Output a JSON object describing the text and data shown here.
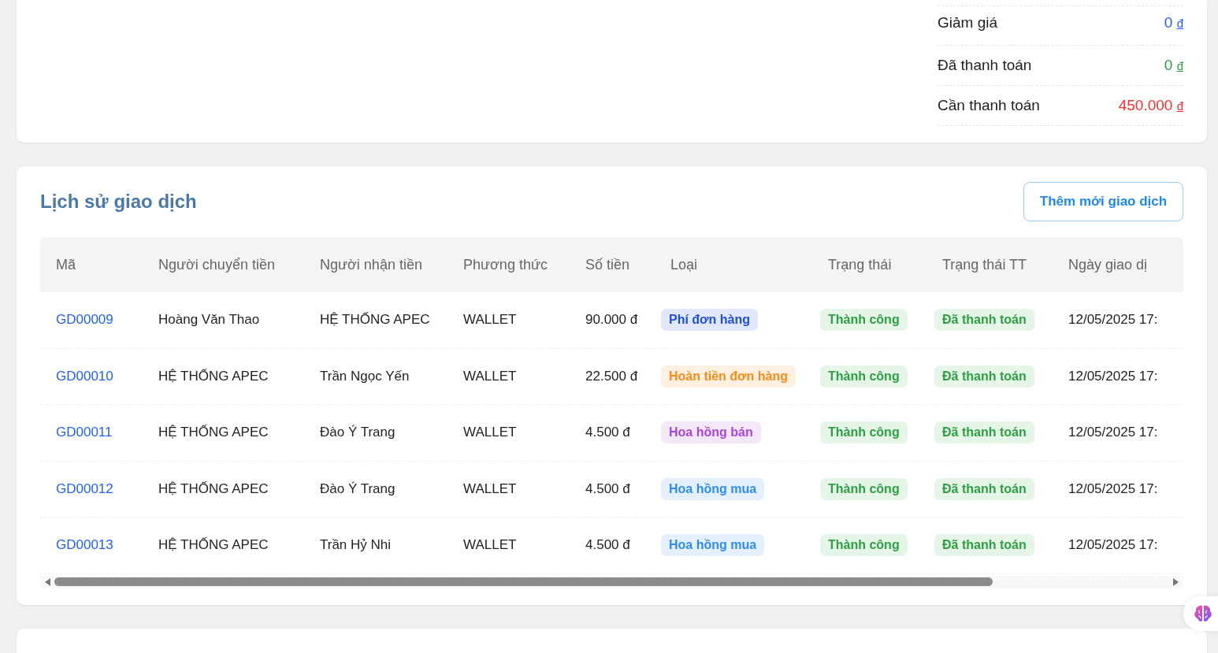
{
  "summary": [
    {
      "label": "Giảm giá",
      "value": "0",
      "currency": "đ",
      "color": "#1f5eff"
    },
    {
      "label": "Đã thanh toán",
      "value": "0",
      "currency": "đ",
      "color": "#2ea043"
    },
    {
      "label": "Cần thanh toán",
      "value": "450.000",
      "currency": "đ",
      "color": "#ff2d2d"
    }
  ],
  "transactions": {
    "title": "Lịch sử giao dịch",
    "add_button": "Thêm mới giao dịch",
    "columns": [
      "Mã",
      "Người chuyển tiền",
      "Người nhận tiền",
      "Phương thức",
      "Số tiền",
      "Loại",
      "Trạng thái",
      "Trạng thái TT",
      "Ngày giao dị"
    ],
    "rows": [
      {
        "code": "GD00009",
        "sender": "Hoàng Văn Thao",
        "receiver": "HỆ THỐNG APEC",
        "method": "WALLET",
        "amount": "90.000 đ",
        "type": {
          "label": "Phí đơn hàng",
          "color": "#1f4fe0"
        },
        "status": "Thành công",
        "payment_status": "Đã thanh toán",
        "date": "12/05/2025 17:"
      },
      {
        "code": "GD00010",
        "sender": "HỆ THỐNG APEC",
        "receiver": "Trần Ngọc Yến",
        "method": "WALLET",
        "amount": "22.500 đ",
        "type": {
          "label": "Hoàn tiền đơn hàng",
          "color": "#fa8c16"
        },
        "status": "Thành công",
        "payment_status": "Đã thanh toán",
        "date": "12/05/2025 17:"
      },
      {
        "code": "GD00011",
        "sender": "HỆ THỐNG APEC",
        "receiver": "Đào Ý Trang",
        "method": "WALLET",
        "amount": "4.500 đ",
        "type": {
          "label": "Hoa hồng bán",
          "color": "#a846d8"
        },
        "status": "Thành công",
        "payment_status": "Đã thanh toán",
        "date": "12/05/2025 17:"
      },
      {
        "code": "GD00012",
        "sender": "HỆ THỐNG APEC",
        "receiver": "Đào Ý Trang",
        "method": "WALLET",
        "amount": "4.500 đ",
        "type": {
          "label": "Hoa hồng mua",
          "color": "#2f8df0"
        },
        "status": "Thành công",
        "payment_status": "Đã thanh toán",
        "date": "12/05/2025 17:"
      },
      {
        "code": "GD00013",
        "sender": "HỆ THỐNG APEC",
        "receiver": "Trần Hỷ Nhi",
        "method": "WALLET",
        "amount": "4.500 đ",
        "type": {
          "label": "Hoa hồng mua",
          "color": "#2f8df0"
        },
        "status": "Thành công",
        "payment_status": "Đã thanh toán",
        "date": "12/05/2025 17:"
      }
    ]
  }
}
